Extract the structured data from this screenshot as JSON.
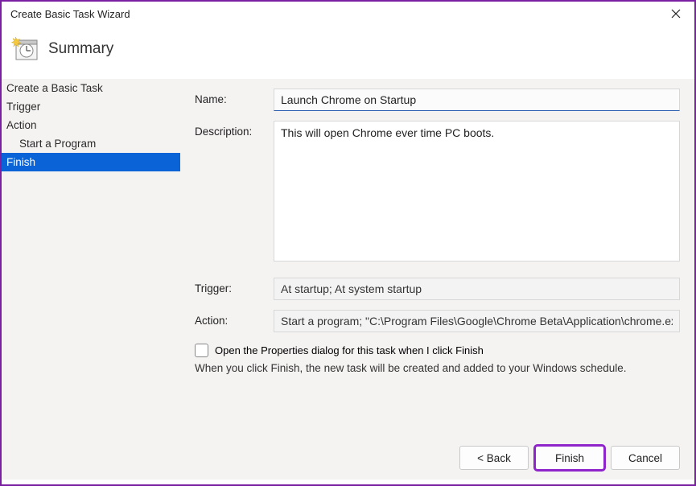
{
  "window": {
    "title": "Create Basic Task Wizard"
  },
  "header": {
    "page_title": "Summary"
  },
  "sidebar": {
    "items": [
      {
        "label": "Create a Basic Task",
        "indent": false,
        "selected": false
      },
      {
        "label": "Trigger",
        "indent": false,
        "selected": false
      },
      {
        "label": "Action",
        "indent": false,
        "selected": false
      },
      {
        "label": "Start a Program",
        "indent": true,
        "selected": false
      },
      {
        "label": "Finish",
        "indent": false,
        "selected": true
      }
    ]
  },
  "form": {
    "name_label": "Name:",
    "name_value": "Launch Chrome on Startup",
    "description_label": "Description:",
    "description_value": "This will open Chrome ever time PC boots.",
    "trigger_label": "Trigger:",
    "trigger_value": "At startup; At system startup",
    "action_label": "Action:",
    "action_value": "Start a program; \"C:\\Program Files\\Google\\Chrome Beta\\Application\\chrome.ex",
    "checkbox_label": "Open the Properties dialog for this task when I click Finish",
    "info_text": "When you click Finish, the new task will be created and added to your Windows schedule."
  },
  "buttons": {
    "back": "< Back",
    "finish": "Finish",
    "cancel": "Cancel"
  }
}
